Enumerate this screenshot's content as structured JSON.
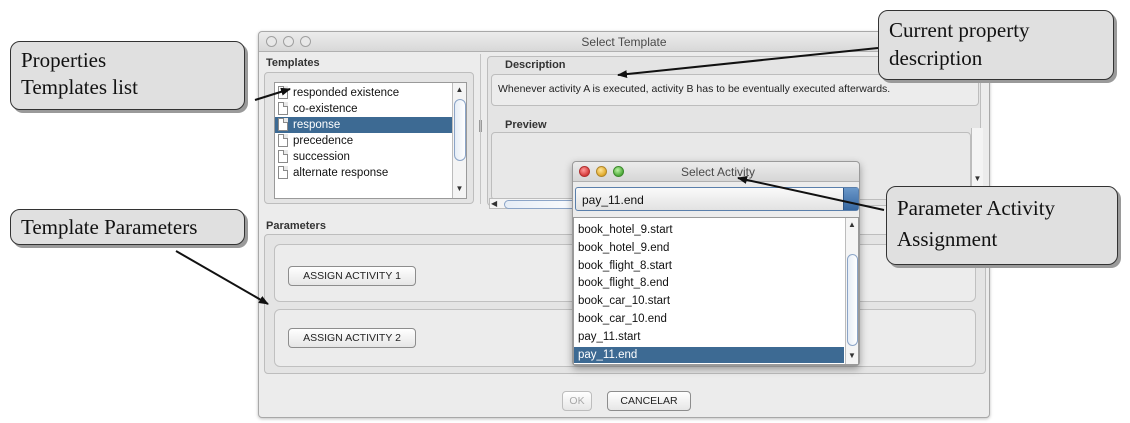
{
  "window": {
    "title": "Select Template"
  },
  "templates": {
    "label": "Templates",
    "items": [
      "responded existence",
      "co-existence",
      "response",
      "precedence",
      "succession",
      "alternate response"
    ],
    "selected_index": 2
  },
  "description": {
    "label": "Description",
    "text": "Whenever activity A is executed, activity B has to be eventually executed afterwards."
  },
  "preview": {
    "label": "Preview"
  },
  "parameters": {
    "label": "Parameters",
    "assign1_label": "ASSIGN ACTIVITY 1",
    "assign2_label": "ASSIGN ACTIVITY 2"
  },
  "footer": {
    "ok_label": "OK",
    "cancel_label": "CANCELAR"
  },
  "select_activity": {
    "title": "Select Activity",
    "selected_value": "pay_11.end",
    "options": [
      "book_hotel_9.start",
      "book_hotel_9.end",
      "book_flight_8.start",
      "book_flight_8.end",
      "book_car_10.start",
      "book_car_10.end",
      "pay_11.start",
      "pay_11.end"
    ],
    "highlighted_index": 7
  },
  "annotations": {
    "properties_templates_list": {
      "line1": "Properties",
      "line2": "Templates list"
    },
    "current_property_description": {
      "line1": "Current property",
      "line2": "description"
    },
    "template_parameters": {
      "line1": "Template Parameters"
    },
    "parameter_activity_assignment": {
      "line1": "Parameter Activity",
      "line2": "Assignment"
    }
  },
  "colors": {
    "selection": "#3d6a93",
    "callout_fill": "#e0e0e0",
    "window_bg": "#ececec"
  }
}
